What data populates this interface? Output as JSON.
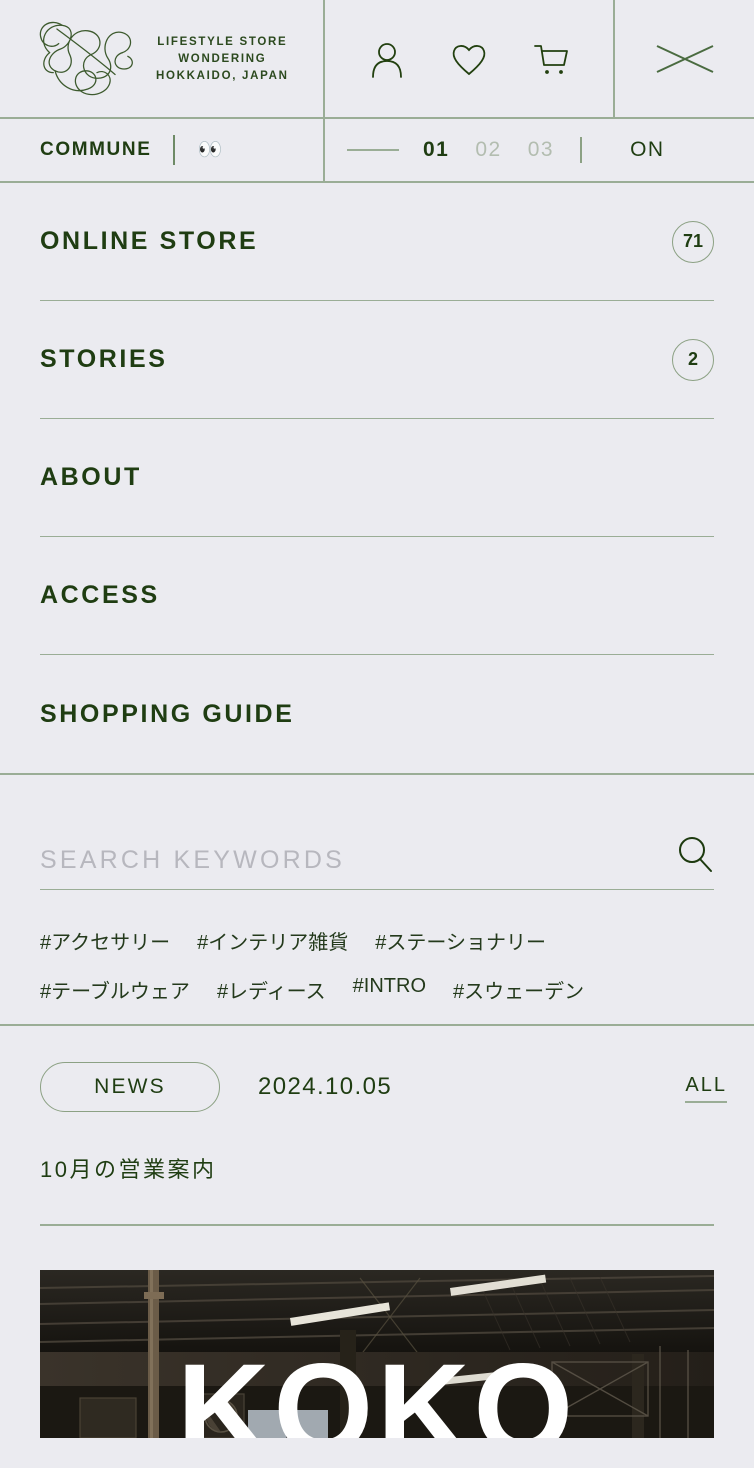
{
  "theme": {
    "background": "#ebebf0",
    "ink": "#1f3d12",
    "rule": "#9aad96",
    "muted": "#b3bdb0"
  },
  "header": {
    "brand": {
      "logo_icon": "squiggle-logo-icon",
      "line1": "LIFESTYLE STORE",
      "line2": "WONDERING",
      "line3": "HOKKAIDO, JAPAN"
    },
    "utilities": [
      {
        "name": "account-icon",
        "label": "Account"
      },
      {
        "name": "wishlist-heart-icon",
        "label": "Wishlist"
      },
      {
        "name": "cart-icon",
        "label": "Cart"
      }
    ],
    "close_icon": "close-icon"
  },
  "subbar": {
    "commune_label": "COMMUNE",
    "eyes_emoji": "👀",
    "pagination": [
      {
        "label": "01",
        "active": true
      },
      {
        "label": "02",
        "active": false
      },
      {
        "label": "03",
        "active": false
      }
    ],
    "toggle_label": "ON"
  },
  "nav": {
    "items": [
      {
        "label": "ONLINE STORE",
        "badge": "71"
      },
      {
        "label": "STORIES",
        "badge": "2"
      },
      {
        "label": "ABOUT",
        "badge": ""
      },
      {
        "label": "ACCESS",
        "badge": ""
      },
      {
        "label": "SHOPPING GUIDE",
        "badge": ""
      }
    ]
  },
  "search": {
    "placeholder": "SEARCH KEYWORDS",
    "value": "",
    "icon": "search-icon"
  },
  "tags": [
    "#アクセサリー",
    "#インテリア雑貨",
    "#ステーショナリー",
    "#テーブルウェア",
    "#レディース",
    "#INTRO",
    "#スウェーデン"
  ],
  "news": {
    "category_label": "NEWS",
    "date": "2024.10.05",
    "all_label": "ALL",
    "title": "10月の営業案内"
  },
  "hero": {
    "headline": "KOKO"
  }
}
